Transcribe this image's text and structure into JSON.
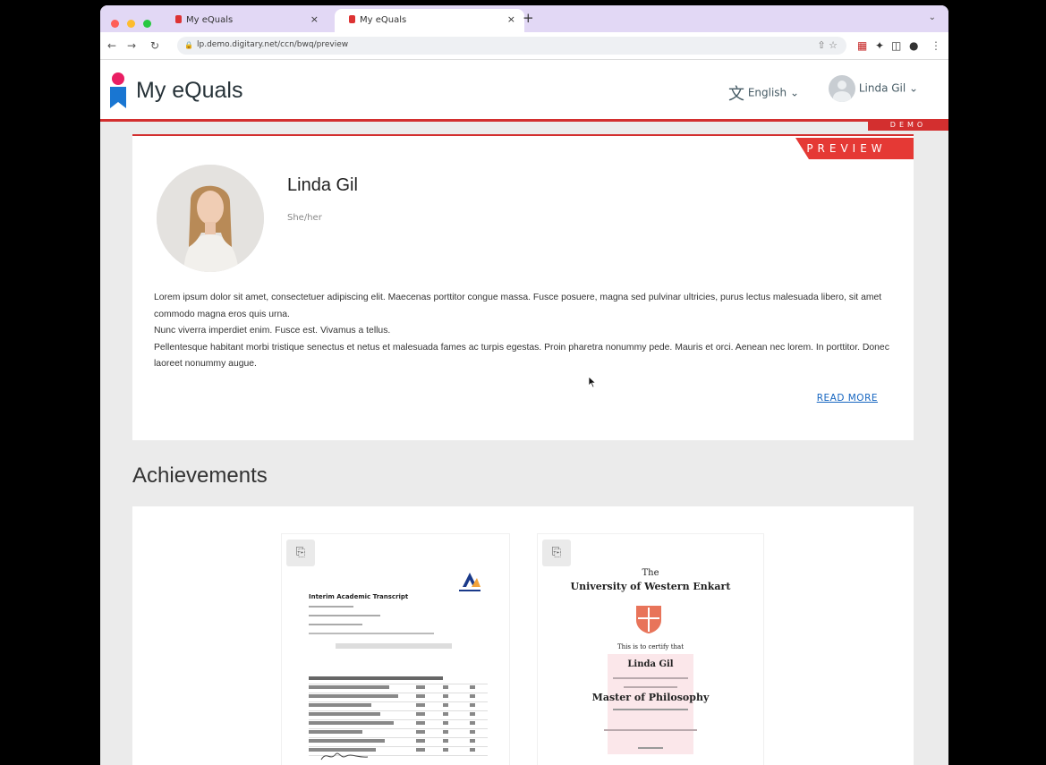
{
  "browser": {
    "tabs": [
      {
        "label": "My eQuals"
      },
      {
        "label": "My eQuals"
      }
    ],
    "new_tab": "+",
    "close_glyph": "×",
    "url": "lp.demo.digitary.net/ccn/bwq/preview"
  },
  "header": {
    "logo_text": "My eQuals",
    "language": "English",
    "user_name": "Linda Gil",
    "demo_ribbon": "DEMO"
  },
  "profile": {
    "preview_tag": "PREVIEW",
    "name": "Linda Gil",
    "pronouns": "She/her",
    "bio": [
      "Lorem ipsum dolor sit amet, consectetuer adipiscing elit. Maecenas porttitor congue massa. Fusce posuere, magna sed pulvinar ultricies, purus lectus malesuada libero, sit amet commodo magna eros quis urna.",
      "Nunc viverra imperdiet enim. Fusce est. Vivamus a tellus.",
      "Pellentesque habitant morbi tristique senectus et netus et malesuada fames ac turpis egestas. Proin pharetra nonummy pede. Mauris et orci. Aenean nec lorem. In porttitor. Donec laoreet nonummy augue."
    ],
    "read_more": "READ MORE"
  },
  "achievements": {
    "title": "Achievements",
    "items": [
      {
        "kind": "transcript",
        "heading": "Interim Academic Transcript"
      },
      {
        "kind": "diploma",
        "line1": "The",
        "line2": "University of Western Enkart",
        "line3": "This is to certify that",
        "recipient": "Linda Gil",
        "degree": "Master of Philosophy"
      }
    ]
  },
  "colors": {
    "accent": "#d32f2f",
    "link": "#1565c0",
    "tabbar": "#e2d8f5",
    "page_bg": "#ebebeb"
  }
}
